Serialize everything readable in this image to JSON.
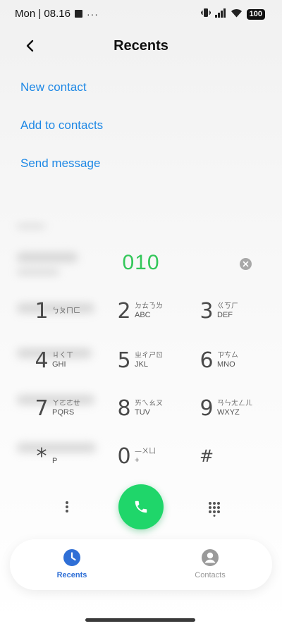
{
  "status_bar": {
    "time": "Mon | 08.16",
    "more": "···",
    "battery": "100"
  },
  "header": {
    "title": "Recents"
  },
  "actions": {
    "new_contact": "New contact",
    "add_to_contacts": "Add to contacts",
    "send_message": "Send message"
  },
  "dialer": {
    "number": "010"
  },
  "keypad": [
    {
      "digit": "1",
      "zhuyin": "ㄅㄆㄇㄈ",
      "latin": ""
    },
    {
      "digit": "2",
      "zhuyin": "ㄉㄊㄋㄌ",
      "latin": "ABC"
    },
    {
      "digit": "3",
      "zhuyin": "ㄍㄎㄏ",
      "latin": "DEF"
    },
    {
      "digit": "4",
      "zhuyin": "ㄐㄑㄒ",
      "latin": "GHI"
    },
    {
      "digit": "5",
      "zhuyin": "ㄓㄔㄕㄖ",
      "latin": "JKL"
    },
    {
      "digit": "6",
      "zhuyin": "ㄗㄘㄙ",
      "latin": "MNO"
    },
    {
      "digit": "7",
      "zhuyin": "ㄚㄛㄜㄝ",
      "latin": "PQRS"
    },
    {
      "digit": "8",
      "zhuyin": "ㄞㄟㄠㄡ",
      "latin": "TUV"
    },
    {
      "digit": "9",
      "zhuyin": "ㄢㄣㄤㄥㄦ",
      "latin": "WXYZ"
    },
    {
      "digit": "*",
      "zhuyin": "",
      "latin": "P"
    },
    {
      "digit": "0",
      "zhuyin": "—ㄨㄩ",
      "latin": "+"
    },
    {
      "digit": "#",
      "zhuyin": "",
      "latin": ""
    }
  ],
  "nav": {
    "recents": "Recents",
    "contacts": "Contacts"
  },
  "colors": {
    "accent": "#1e88e5",
    "call_green": "#1fd66a",
    "number_green": "#33c75a",
    "nav_active": "#2f6fd6",
    "nav_inactive": "#9a9a9a"
  },
  "icons": {
    "back": "back-arrow-icon",
    "clear": "clear-icon",
    "call": "phone-icon",
    "more": "more-vertical-icon",
    "dialpad": "dialpad-grid-icon",
    "recents": "clock-icon",
    "contacts": "person-icon",
    "signal": "signal-icon",
    "wifi": "wifi-icon",
    "vibrate": "vibrate-icon"
  }
}
